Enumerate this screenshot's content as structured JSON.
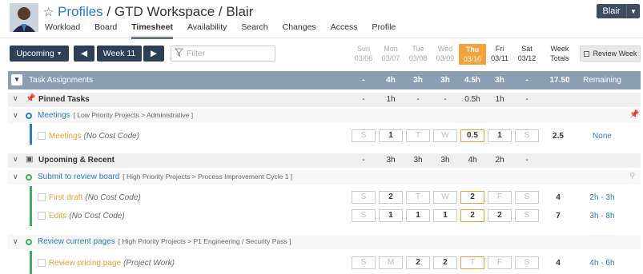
{
  "header": {
    "breadcrumb": [
      "Profiles",
      "GTD Workspace",
      "Blair"
    ],
    "user_button": "Blair",
    "nav": [
      "Workload",
      "Board",
      "Timesheet",
      "Availability",
      "Search",
      "Changes",
      "Access",
      "Profile"
    ],
    "active_nav": "Timesheet"
  },
  "toolbar": {
    "range": "Upcoming",
    "week": "Week 11",
    "filter_placeholder": "Filter",
    "review_week": "Review Week",
    "week_totals": [
      "Week",
      "Totals"
    ]
  },
  "days": [
    {
      "dow": "Sun",
      "date": "03/06"
    },
    {
      "dow": "Mon",
      "date": "03/07"
    },
    {
      "dow": "Tue",
      "date": "03/08"
    },
    {
      "dow": "Wed",
      "date": "03/09"
    },
    {
      "dow": "Thu",
      "date": "03/10"
    },
    {
      "dow": "Fri",
      "date": "03/11"
    },
    {
      "dow": "Sat",
      "date": "03/12"
    }
  ],
  "task_assignments": {
    "label": "Task Assignments",
    "hours": [
      "-",
      "4h",
      "3h",
      "3h",
      "4.5h",
      "3h",
      "-"
    ],
    "total": "17.50",
    "remaining": "Remaining"
  },
  "sections": {
    "pinned": {
      "label": "Pinned Tasks",
      "hours": [
        "-",
        "1h",
        "-",
        "-",
        "0.5h",
        "1h",
        "-"
      ]
    },
    "upcoming": {
      "label": "Upcoming & Recent",
      "hours": [
        "-",
        "3h",
        "3h",
        "3h",
        "4h",
        "2h",
        "-"
      ]
    }
  },
  "tasks": {
    "meetings": {
      "name": "Meetings",
      "path": "[ Low Priority Projects > Administrative ]",
      "color": "#2a7bc4",
      "entries": [
        {
          "name": "Meetings",
          "code": "(No Cost Code)",
          "cells": [
            "S",
            "1",
            "T",
            "W",
            "0.5",
            "1",
            "S"
          ],
          "total": "2.5",
          "remaining": "None"
        }
      ]
    },
    "review_board": {
      "name": "Submit to review board",
      "path": "[ High Priority Projects > Process Improvement Cycle 1 ]",
      "color": "#3cae5c",
      "entries": [
        {
          "name": "First draft",
          "code": "(No Cost Code)",
          "cells": [
            "S",
            "2",
            "T",
            "W",
            "2",
            "F",
            "S"
          ],
          "total": "4",
          "remaining": "2h - 3h"
        },
        {
          "name": "Edits",
          "code": "(No Cost Code)",
          "cells": [
            "S",
            "1",
            "1",
            "1",
            "2",
            "2",
            "S"
          ],
          "total": "7",
          "remaining": "3h - 8h"
        }
      ]
    },
    "review_pages": {
      "name": "Review current pages",
      "path": "[ High Priority Projects > P1 Engineering / Security Pass ]",
      "color": "#3cae5c",
      "entries": [
        {
          "name": "Review pricing page",
          "code": "(Project Work)",
          "cells": [
            "S",
            "M",
            "2",
            "2",
            "T",
            "F",
            "S"
          ],
          "total": "4",
          "remaining": "4h - 6h"
        }
      ]
    }
  }
}
